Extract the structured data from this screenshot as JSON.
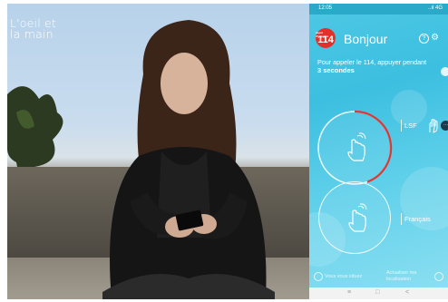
{
  "video": {
    "watermark_line1": "L'oeil et",
    "watermark_line2": "la main"
  },
  "phone": {
    "status": {
      "time": "12:05",
      "signal": "..ıl 4G"
    },
    "app_logo_small": "appel d'urgence",
    "app_logo_number": "114",
    "greeting": "Bonjour",
    "help_icon": "?",
    "settings_icon": "⚙",
    "instruction": "Pour appeler le 114, appuyer pendant",
    "duration": "3 secondes",
    "options": [
      {
        "label": "LSF",
        "icon": "tap-hand-icon"
      },
      {
        "label": "Français",
        "icon": "tap-hand-icon"
      }
    ],
    "more_badge": "···",
    "bottom": {
      "left": "Vous vous situez",
      "right_line1": "Actualiser ma",
      "right_line2": "localisation"
    },
    "nav": {
      "menu": "≡",
      "home": "□",
      "back": "<"
    },
    "colors": {
      "accent": "#e4302b",
      "background": "#3cbfe0"
    }
  }
}
